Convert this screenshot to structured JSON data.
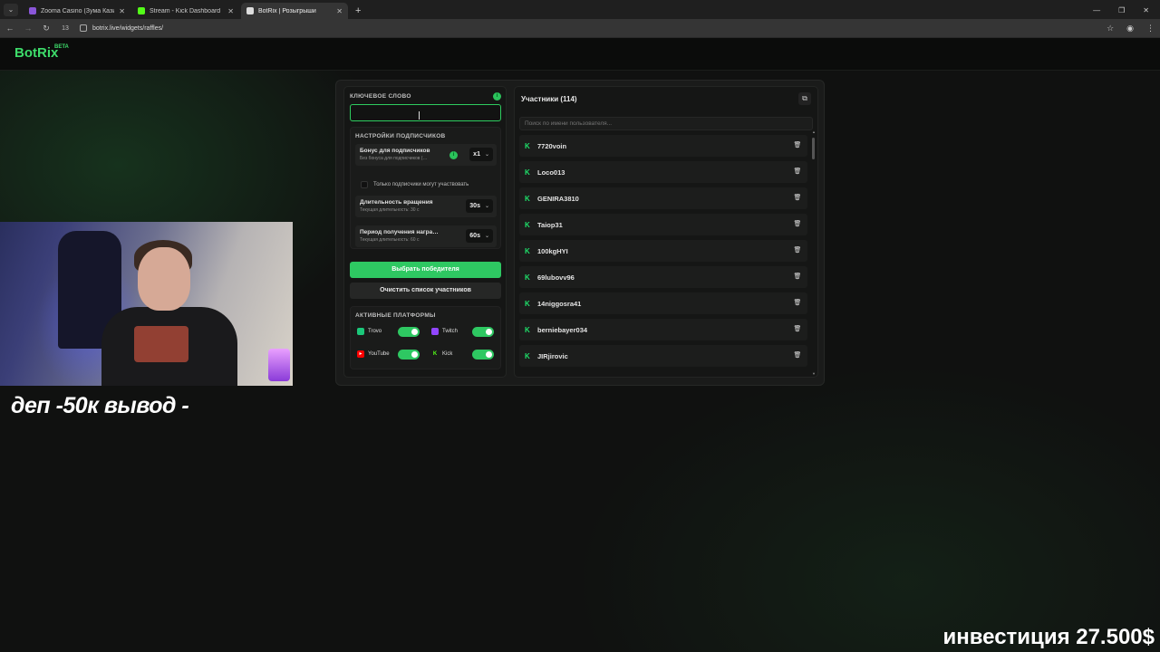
{
  "browser": {
    "tab_menu_icon": "chevron-down-icon",
    "tabs": [
      {
        "title": "Zooma Casino (Зума Кази…",
        "favicon_color": "#8a56d8",
        "active": false
      },
      {
        "title": "Stream - Kick Dashboard",
        "favicon_color": "#53fc18",
        "active": false
      },
      {
        "title": "BotRix | Розыгрыши",
        "favicon_color": "#dddddd",
        "active": true
      }
    ],
    "new_tab": "+",
    "url": "botrix.live/widgets/raffles/",
    "tab_count": "13"
  },
  "site": {
    "logo": "BotRix",
    "logo_badge": "BETA"
  },
  "raffle": {
    "keyword_label": "КЛЮЧЕВОЕ СЛОВО",
    "keyword_value": "",
    "subscriber_settings_label": "НАСТРОЙКИ ПОДПИСЧИКОВ",
    "subscriber_bonus": {
      "title": "Бонус для подписчиков",
      "subtitle": "Без бонуса для подписчиков (…",
      "value": "x1"
    },
    "subscribers_only_label": "Только подписчики могут участвовать",
    "spin_duration": {
      "title": "Длительность вращения",
      "subtitle": "Текущая длительность: 30 с",
      "value": "30s"
    },
    "award_period": {
      "title": "Период получения награ…",
      "subtitle": "Текущая длительность: 60 с",
      "value": "60s"
    },
    "pick_winner_button": "Выбрать победителя",
    "clear_list_button": "Очистить список участников",
    "platforms_label": "АКТИВНЫЕ ПЛАТФОРМЫ",
    "platforms": [
      {
        "name": "Trovo",
        "color": "#1bc77a",
        "enabled": true
      },
      {
        "name": "Twitch",
        "color": "#9146ff",
        "enabled": true
      },
      {
        "name": "YouTube",
        "color": "#ff0000",
        "enabled": true
      },
      {
        "name": "Kick",
        "color": "#53fc18",
        "enabled": true
      }
    ]
  },
  "participants": {
    "title": "Участники (114)",
    "search_placeholder": "Поиск по имени пользователя...",
    "users": [
      "7720voin",
      "Loco013",
      "GENIRA3810",
      "Taiop31",
      "100kgHYI",
      "69lubovv96",
      "14niggosra41",
      "berniebayer034",
      "JIRjirovic"
    ]
  },
  "stream_overlay": {
    "left_text": "деп -50к вывод -",
    "right_text": "инвестиция 27.500$"
  },
  "colors": {
    "accent": "#2ec862",
    "background": "#101110",
    "kick_green": "#1fe06a"
  }
}
